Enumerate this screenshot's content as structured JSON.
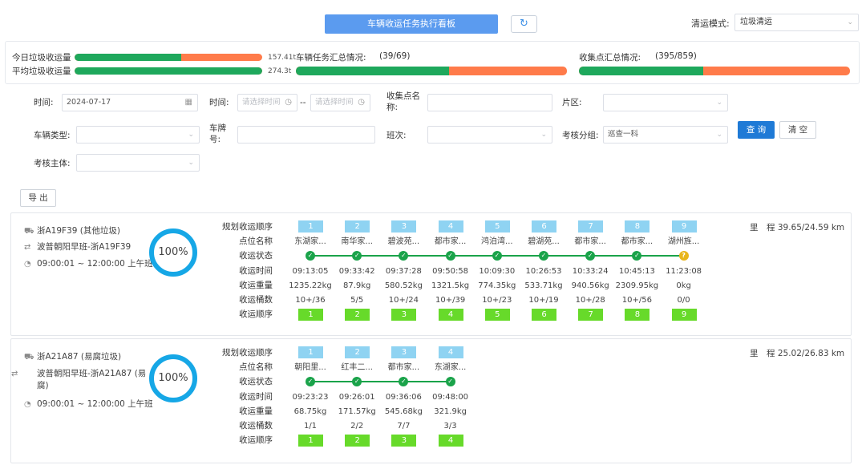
{
  "header": {
    "title_button": "车辆收运任务执行看板",
    "mode_label": "清运模式:",
    "mode_value": "垃圾清运"
  },
  "summary": {
    "today_label": "今日垃圾收运量",
    "today_value": "157.41t",
    "today_fraction": 0.57,
    "avg_label": "平均垃圾收运量",
    "avg_value": "274.3t",
    "avg_fraction": 1.0,
    "task_label": "车辆任务汇总情况:",
    "task_value": "(39/69)",
    "task_fraction": 0.565,
    "point_label": "收集点汇总情况:",
    "point_value": "(395/859)",
    "point_fraction": 0.46,
    "colors": {
      "done": "#1ea85c",
      "remaining": "#ff7b4a"
    }
  },
  "filters": {
    "date_label": "时间:",
    "date_value": "2024-07-17",
    "time_label": "时间:",
    "time_start_placeholder": "请选择时间",
    "time_sep": "--",
    "time_end_placeholder": "请选择时间",
    "point_name_label": "收集点名称:",
    "area_label": "片区:",
    "vehicle_type_label": "车辆类型:",
    "plate_label": "车牌号:",
    "shift_label": "班次:",
    "group_label": "考核分组:",
    "group_value": "巡查一科",
    "subject_label": "考核主体:",
    "query_button": "查 询",
    "clear_button": "清 空",
    "export_button": "导 出"
  },
  "row_labels": [
    "规划收运顺序",
    "点位名称",
    "收运状态",
    "收运时间",
    "收运重量",
    "收运桶数",
    "收运顺序"
  ],
  "vehicles": [
    {
      "plate": "浙A19F39 (其他垃圾)",
      "route": "波普朝阳早班-浙A19F39",
      "shift_time": "09:00:01 ~ 12:00:00 上午班",
      "progress": "100%",
      "mileage": "里　程 39.65/24.59 km",
      "points": [
        {
          "seq": "1",
          "name": "东湖家...",
          "status": "done",
          "time": "09:13:05",
          "weight": "1235.22kg",
          "bins": "10+/36",
          "order": "1"
        },
        {
          "seq": "2",
          "name": "南华家...",
          "status": "done",
          "time": "09:33:42",
          "weight": "87.9kg",
          "bins": "5/5",
          "order": "2"
        },
        {
          "seq": "3",
          "name": "碧波苑...",
          "status": "done",
          "time": "09:37:28",
          "weight": "580.52kg",
          "bins": "10+/24",
          "order": "3"
        },
        {
          "seq": "4",
          "name": "都市家...",
          "status": "done",
          "time": "09:50:58",
          "weight": "1321.5kg",
          "bins": "10+/39",
          "order": "4"
        },
        {
          "seq": "5",
          "name": "鸿泊湾...",
          "status": "done",
          "time": "10:09:30",
          "weight": "774.35kg",
          "bins": "10+/23",
          "order": "5"
        },
        {
          "seq": "6",
          "name": "碧湖苑...",
          "status": "done",
          "time": "10:26:53",
          "weight": "533.71kg",
          "bins": "10+/19",
          "order": "6"
        },
        {
          "seq": "7",
          "name": "都市家...",
          "status": "done",
          "time": "10:33:24",
          "weight": "940.56kg",
          "bins": "10+/28",
          "order": "7"
        },
        {
          "seq": "8",
          "name": "都市家...",
          "status": "done",
          "time": "10:45:13",
          "weight": "2309.95kg",
          "bins": "10+/56",
          "order": "8"
        },
        {
          "seq": "9",
          "name": "湖州旌...",
          "status": "unknown",
          "time": "11:23:08",
          "weight": "0kg",
          "bins": "0/0",
          "order": "9"
        }
      ]
    },
    {
      "plate": "浙A21A87 (易腐垃圾)",
      "route": "波普朝阳早班-浙A21A87 (易腐)",
      "shift_time": "09:00:01 ~ 12:00:00 上午班",
      "progress": "100%",
      "mileage": "里　程 25.02/26.83 km",
      "points": [
        {
          "seq": "1",
          "name": "朝阳里...",
          "status": "done",
          "time": "09:23:23",
          "weight": "68.75kg",
          "bins": "1/1",
          "order": "1"
        },
        {
          "seq": "2",
          "name": "红丰二...",
          "status": "done",
          "time": "09:26:01",
          "weight": "171.57kg",
          "bins": "2/2",
          "order": "2"
        },
        {
          "seq": "3",
          "name": "都市家...",
          "status": "done",
          "time": "09:36:06",
          "weight": "545.68kg",
          "bins": "7/7",
          "order": "3"
        },
        {
          "seq": "4",
          "name": "东湖家...",
          "status": "done",
          "time": "09:48:00",
          "weight": "321.9kg",
          "bins": "3/3",
          "order": "4"
        }
      ]
    }
  ]
}
